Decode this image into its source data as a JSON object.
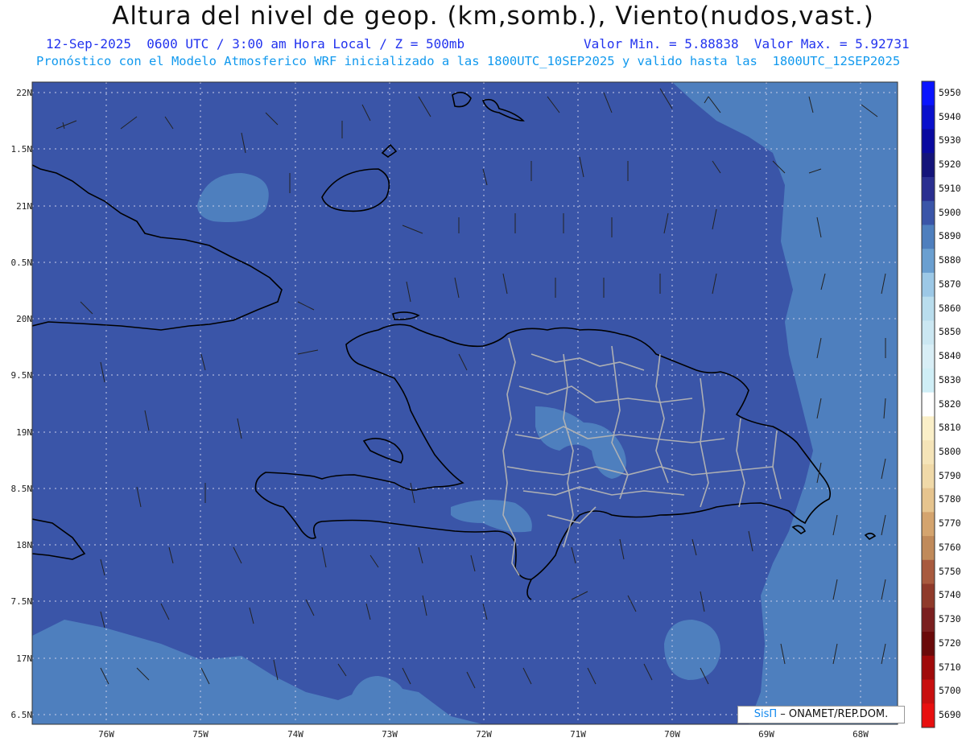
{
  "header": {
    "title": "Altura del nivel de geop. (km,somb.), Viento(nudos,vast.)",
    "date_time": "12-Sep-2025  0600 UTC / 3:00 am Hora Local / Z = 500mb",
    "min_max": "Valor Min. = 5.88838  Valor Max. = 5.92731",
    "forecast_note": "Pronóstico con el Modelo Atmosferico WRF inicializado a las 1800UTC_10SEP2025 y valido hasta las  1800UTC_12SEP2025"
  },
  "axes": {
    "lat_labels": [
      "22N",
      "1.5N",
      "21N",
      "0.5N",
      "20N",
      "9.5N",
      "19N",
      "8.5N",
      "18N",
      "7.5N",
      "17N",
      "6.5N"
    ],
    "lon_labels": [
      "76W",
      "75W",
      "74W",
      "73W",
      "72W",
      "71W",
      "70W",
      "69W",
      "68W"
    ]
  },
  "colorbar": {
    "levels": [
      "5950",
      "5940",
      "5930",
      "5920",
      "5910",
      "5900",
      "5890",
      "5880",
      "5870",
      "5860",
      "5850",
      "5840",
      "5830",
      "5820",
      "5810",
      "5800",
      "5790",
      "5780",
      "5770",
      "5760",
      "5750",
      "5740",
      "5730",
      "5720",
      "5710",
      "5700",
      "5690"
    ],
    "colors": [
      "#0a14ff",
      "#0a10cc",
      "#0a0aa0",
      "#14147a",
      "#2a2f90",
      "#3a55a8",
      "#4e7fbe",
      "#6a9fd0",
      "#9cc8e6",
      "#b9dded",
      "#cbe7f2",
      "#d8eef6",
      "#cfeef6",
      "#ffffff",
      "#faefc8",
      "#f5e4b8",
      "#f0d9a8",
      "#e6c48e",
      "#d4a46e",
      "#c08a5a",
      "#a85a3e",
      "#8f3a2a",
      "#7a1f1f",
      "#6a0a0a",
      "#a00a0a",
      "#c80f0f",
      "#e80f0f"
    ]
  },
  "map": {
    "field_colors": {
      "main": "#3a55a8",
      "lighter": "#4e7fbe",
      "lightest": "#6a9fd0"
    }
  },
  "credit": {
    "brand": "SisΠ",
    "text": " – ONAMET/REP.DOM."
  }
}
